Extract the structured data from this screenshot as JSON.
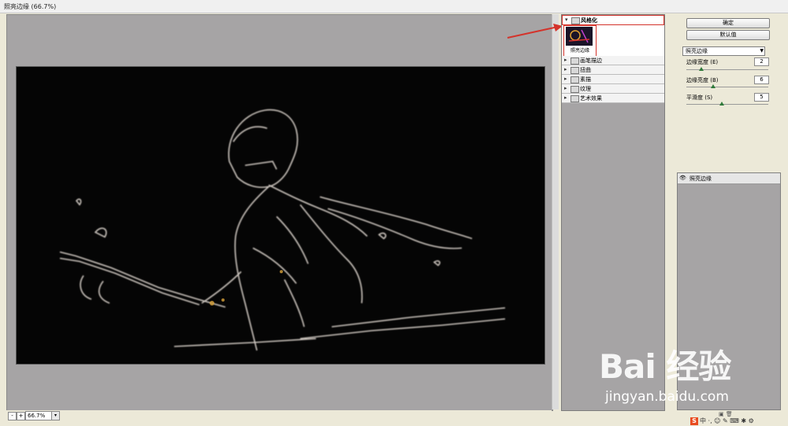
{
  "window": {
    "title": "照亮边缘 (66.7%)"
  },
  "status": {
    "zoom": "66.7%",
    "zoom_out": "-",
    "zoom_in": "+",
    "dropdown": "▾"
  },
  "gallery": {
    "open_category": "风格化",
    "filter_thumb_label": "照亮边缘",
    "categories": [
      "画笔描边",
      "扭曲",
      "素描",
      "纹理",
      "艺术效果"
    ]
  },
  "settings": {
    "ok_label": "确定",
    "default_label": "默认值",
    "filter_select": "照亮边缘",
    "params": [
      {
        "label": "边缘宽度 (E)",
        "value": "2",
        "fraction": 0.15
      },
      {
        "label": "边缘亮度 (B)",
        "value": "6",
        "fraction": 0.3
      },
      {
        "label": "平滑度 (S)",
        "value": "5",
        "fraction": 0.4
      }
    ]
  },
  "layers": {
    "items": [
      {
        "name": "照亮边缘"
      }
    ]
  },
  "watermark": {
    "brand": "Bai 经验",
    "url": "jingyan.baidu.com"
  },
  "ime_bar": {
    "logo": "S",
    "text": "中 ·, ☺ ✎ ⌨ ✱ ⚙"
  },
  "colors": {
    "accent_red": "#d4332b",
    "slider_knob": "#2f7a3a",
    "canvas_bg": "#a6a4a5"
  }
}
